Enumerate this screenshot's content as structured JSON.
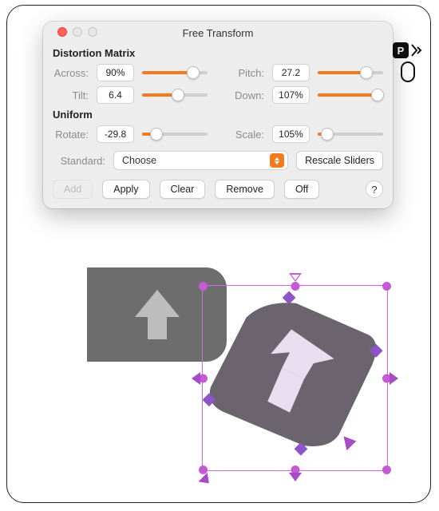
{
  "window": {
    "title": "Free Transform"
  },
  "sections": {
    "distortion": {
      "heading": "Distortion Matrix",
      "across": {
        "label": "Across:",
        "value": "90%",
        "pct": 78
      },
      "pitch": {
        "label": "Pitch:",
        "value": "27.2",
        "pct": 74
      },
      "tilt": {
        "label": "Tilt:",
        "value": "6.4",
        "pct": 55
      },
      "down": {
        "label": "Down:",
        "value": "107%",
        "pct": 92
      }
    },
    "uniform": {
      "heading": "Uniform",
      "rotate": {
        "label": "Rotate:",
        "value": "-29.8",
        "pct": 22
      },
      "scale": {
        "label": "Scale:",
        "value": "105%",
        "pct": 15
      }
    }
  },
  "standard": {
    "label": "Standard:",
    "selected": "Choose"
  },
  "buttons": {
    "rescale": "Rescale Sliders",
    "add": "Add",
    "apply": "Apply",
    "clear": "Clear",
    "remove": "Remove",
    "off": "Off",
    "help": "?"
  },
  "side": {
    "p": "P"
  }
}
